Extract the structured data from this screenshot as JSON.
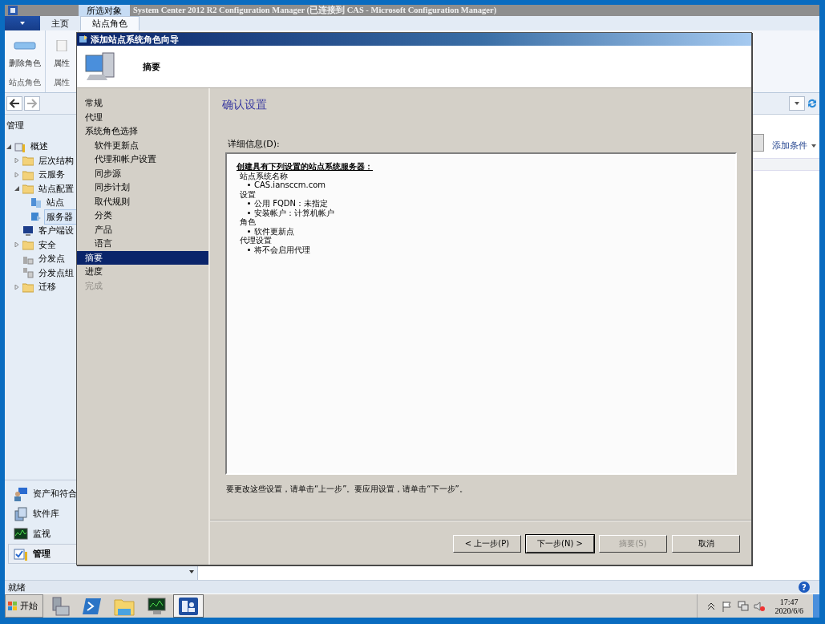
{
  "app": {
    "title": "System Center 2012 R2 Configuration Manager (已连接到 CAS - Microsoft Configuration Manager)",
    "context_tab": "所选对象",
    "tabs": [
      {
        "label": "主页",
        "selected": false
      },
      {
        "label": "站点角色",
        "selected": true
      }
    ],
    "ribbon_groups": [
      {
        "label": "站点角色",
        "buttons": [
          {
            "label": "删除角色",
            "kind": "remove"
          }
        ]
      },
      {
        "label": "属性",
        "buttons": [
          {
            "label": "属性",
            "kind": "properties"
          }
        ]
      }
    ],
    "nav_pane": {
      "title": "管理",
      "tree": [
        {
          "label": "概述",
          "kind": "overview",
          "expanded": true,
          "selected": false,
          "children": [
            {
              "label": "层次结构",
              "kind": "folder",
              "expanded": false,
              "selected": false
            },
            {
              "label": "云服务",
              "kind": "folder",
              "expanded": false,
              "selected": false
            },
            {
              "label": "站点配置",
              "kind": "folder",
              "expanded": true,
              "selected": false,
              "children": [
                {
                  "label": "站点",
                  "kind": "site",
                  "selected": false
                },
                {
                  "label": "服务器",
                  "kind": "server",
                  "selected": true
                }
              ]
            },
            {
              "label": "客户端设",
              "kind": "client",
              "selected": false
            },
            {
              "label": "安全",
              "kind": "folder",
              "expanded": false,
              "selected": false
            },
            {
              "label": "分发点",
              "kind": "dp",
              "selected": false
            },
            {
              "label": "分发点组",
              "kind": "dpgroup",
              "selected": false
            },
            {
              "label": "迁移",
              "kind": "folder",
              "expanded": false,
              "selected": false
            }
          ]
        }
      ],
      "workspaces": [
        {
          "label": "资产和符合",
          "kind": "assets",
          "selected": false
        },
        {
          "label": "软件库",
          "kind": "library",
          "selected": false
        },
        {
          "label": "监视",
          "kind": "monitoring",
          "selected": false
        },
        {
          "label": "管理",
          "kind": "administration",
          "selected": true
        }
      ]
    },
    "filter": {
      "add_criteria": "添加条件"
    },
    "status_bar": "就绪",
    "help": "?"
  },
  "dialog": {
    "title": "添加站点系统角色向导",
    "header": "摘要",
    "steps": [
      {
        "label": "常规",
        "selected": false,
        "disabled": false
      },
      {
        "label": "代理",
        "selected": false,
        "disabled": false
      },
      {
        "label": "系统角色选择",
        "selected": false,
        "disabled": false,
        "children": [
          {
            "label": "软件更新点",
            "selected": false,
            "disabled": false
          },
          {
            "label": "代理和帐户设置",
            "selected": false,
            "disabled": false
          },
          {
            "label": "同步源",
            "selected": false,
            "disabled": false
          },
          {
            "label": "同步计划",
            "selected": false,
            "disabled": false
          },
          {
            "label": "取代规则",
            "selected": false,
            "disabled": false
          },
          {
            "label": "分类",
            "selected": false,
            "disabled": false
          },
          {
            "label": "产品",
            "selected": false,
            "disabled": false
          },
          {
            "label": "语言",
            "selected": false,
            "disabled": false
          }
        ]
      },
      {
        "label": "摘要",
        "selected": true,
        "disabled": false
      },
      {
        "label": "进度",
        "selected": false,
        "disabled": false
      },
      {
        "label": "完成",
        "selected": false,
        "disabled": true
      }
    ],
    "page_title": "确认设置",
    "details_label": "详细信息(D):",
    "details": {
      "heading": "创建具有下列设置的站点系统服务器：",
      "sections": [
        {
          "title": "站点系统名称",
          "items": [
            "CAS.iansccm.com"
          ]
        },
        {
          "title": "设置",
          "items": [
            "公用 FQDN：未指定",
            "安装帐户：计算机帐户"
          ]
        },
        {
          "title": "角色",
          "items": [
            "软件更新点"
          ]
        },
        {
          "title": "代理设置",
          "items": [
            "将不会启用代理"
          ]
        }
      ]
    },
    "footer_note": "要更改这些设置，请单击“上一步”。要应用设置，请单击“下一步”。",
    "buttons": [
      {
        "label": "< 上一步(P)",
        "disabled": false,
        "default": false
      },
      {
        "label": "下一步(N) >",
        "disabled": false,
        "default": true
      },
      {
        "label": "摘要(S)",
        "disabled": true,
        "default": false
      },
      {
        "label": "取消",
        "disabled": false,
        "default": false
      }
    ]
  },
  "taskbar": {
    "start": "开始",
    "items": [
      {
        "kind": "server-manager",
        "active": false
      },
      {
        "kind": "powershell",
        "active": false
      },
      {
        "kind": "explorer",
        "active": false
      },
      {
        "kind": "monitor",
        "active": false
      },
      {
        "kind": "console",
        "active": true
      }
    ],
    "clock": {
      "time": "17:47",
      "date": "2020/6/6"
    }
  }
}
